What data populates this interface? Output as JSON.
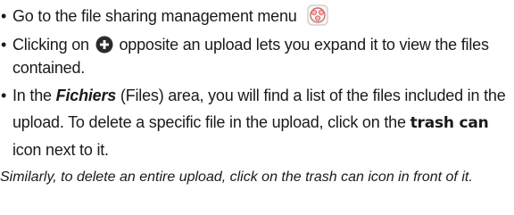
{
  "bullets": [
    {
      "text": "Go to the file sharing management menu"
    },
    {
      "before": "Clicking on",
      "after": "opposite an upload lets you expand it to view the files contained."
    },
    {
      "pre": "In the",
      "em": "Fichiers",
      "mid": "(Files) area, you will find a list of the files included in the upload. To delete a specific file in the upload, click on the",
      "strong": "trash can",
      "post": "icon next to it."
    }
  ],
  "bullet_char": "•",
  "note": "Similarly, to delete an entire upload, click on the trash can icon in front of it.",
  "icons": {
    "share_menu": "share-management-icon",
    "expand": "plus-circle-icon"
  },
  "colors": {
    "icon_ring": "#c9c9c9",
    "icon_fill": "#f4b8b8",
    "icon_accent": "#d86a6a",
    "plus_circle": "#2b2b2b"
  }
}
